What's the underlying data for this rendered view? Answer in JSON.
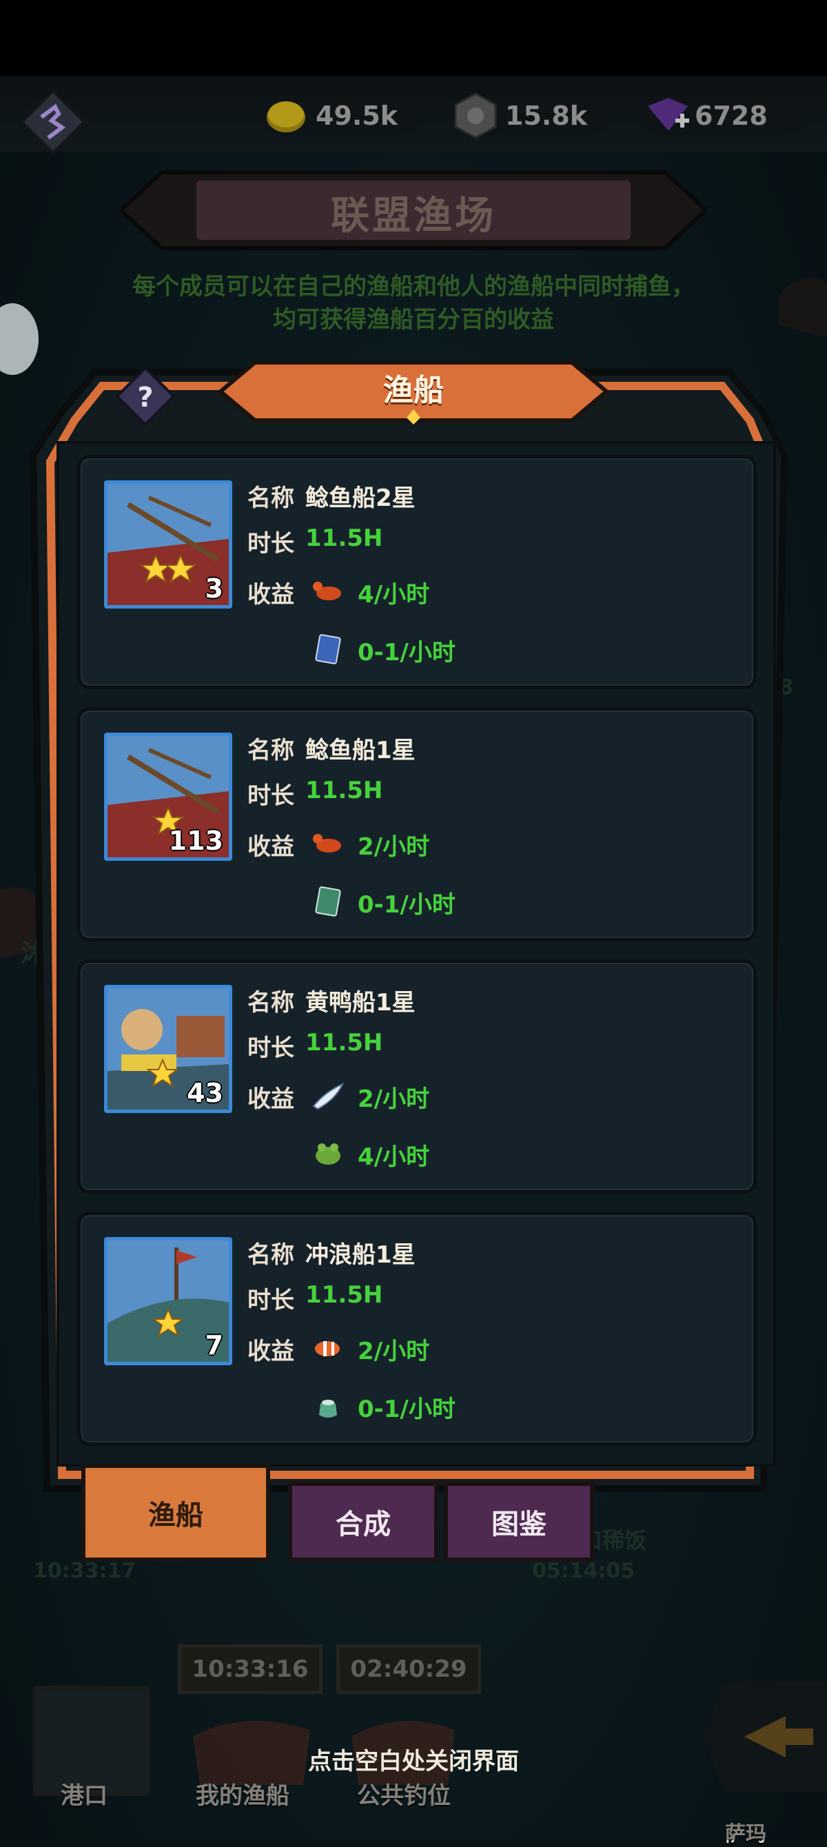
{
  "resources": [
    {
      "name": "gold",
      "icon": "gold-coin-icon",
      "value": "49.5k"
    },
    {
      "name": "gear",
      "icon": "gear-cube-icon",
      "value": "15.8k"
    },
    {
      "name": "gem",
      "icon": "purple-gem-icon",
      "value": "6728"
    }
  ],
  "dialog": {
    "title": "联盟渔场",
    "hint": "每个成员可以在自己的渔船和他人的渔船中同时捕鱼，均可获得渔船百分百的收益",
    "active_tab_header": "渔船"
  },
  "labels": {
    "name": "名称",
    "duration": "时长",
    "income": "收益"
  },
  "boats": [
    {
      "name": "鲶鱼船2星",
      "duration": "11.5H",
      "stars": 2,
      "count": "3",
      "income": [
        {
          "icon": "lobster-icon",
          "value": "4/小时"
        },
        {
          "icon": "blue-card-icon",
          "value": "0-1/小时"
        }
      ]
    },
    {
      "name": "鲶鱼船1星",
      "duration": "11.5H",
      "stars": 1,
      "count": "113",
      "income": [
        {
          "icon": "lobster-icon",
          "value": "2/小时"
        },
        {
          "icon": "green-card-icon",
          "value": "0-1/小时"
        }
      ]
    },
    {
      "name": "黄鸭船1星",
      "duration": "11.5H",
      "stars": 1,
      "count": "43",
      "income": [
        {
          "icon": "feather-fish-icon",
          "value": "2/小时"
        },
        {
          "icon": "green-frog-icon",
          "value": "4/小时"
        }
      ]
    },
    {
      "name": "冲浪船1星",
      "duration": "11.5H",
      "stars": 1,
      "count": "7",
      "income": [
        {
          "icon": "clownfish-icon",
          "value": "2/小时"
        },
        {
          "icon": "green-pouch-icon",
          "value": "0-1/小时"
        }
      ]
    }
  ],
  "tabs": [
    {
      "label": "渔船",
      "active": true
    },
    {
      "label": "合成",
      "active": false
    },
    {
      "label": "图鉴",
      "active": false
    }
  ],
  "background": {
    "left_timer": "10:33:17",
    "right_timer": "05:14:05",
    "right_label": "口稀饭",
    "dock_timers": [
      "10:33:16",
      "02:40:29"
    ],
    "dock_labels": [
      "港口",
      "我的渔船",
      "公共钓位"
    ],
    "far_right_label": "萨玛",
    "side_number": "8",
    "side_char": "沐"
  },
  "close_hint": "点击空白处关闭界面",
  "colors": {
    "accent_orange": "#d9703a",
    "income_green": "#46d23c",
    "tab_purple": "#4e2a50"
  }
}
